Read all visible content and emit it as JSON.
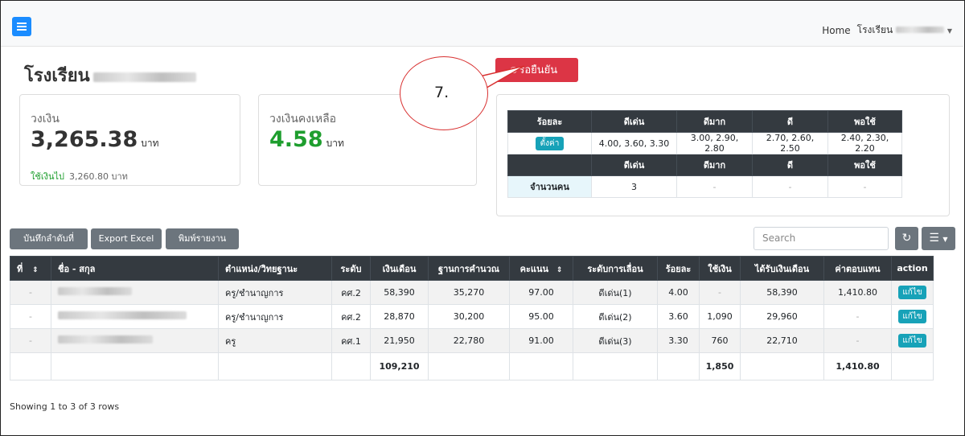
{
  "navbar": {
    "home": "Home",
    "user_menu": "โรงเรียน"
  },
  "title": "โรงเรียน",
  "cards": {
    "budget": {
      "label": "วงเงิน",
      "value": "3,265.38",
      "unit": "บาท",
      "used_label": "ใช้เงินไป",
      "used_value": "3,260.80 บาท"
    },
    "remaining": {
      "label": "วงเงินคงเหลือ",
      "value": "4.58",
      "unit": "บาท"
    }
  },
  "pending_label": "รอยืนยัน",
  "annotation": "7.",
  "rate_table": {
    "header": [
      "ร้อยละ",
      "ดีเด่น",
      "ดีมาก",
      "ดี",
      "พอใช้"
    ],
    "config_label": "ตั้งค่า",
    "percents": [
      "4.00, 3.60, 3.30",
      "3.00, 2.90, 2.80",
      "2.70, 2.60, 2.50",
      "2.40, 2.30, 2.20"
    ],
    "header2": [
      "ดีเด่น",
      "ดีมาก",
      "ดี",
      "พอใช้"
    ],
    "count_label": "จำนวนคน",
    "counts": [
      "3",
      "-",
      "-",
      "-"
    ]
  },
  "toolbar": {
    "save": "บันทึกลำดับที่",
    "export": "Export Excel",
    "print": "พิมพ์รายงาน",
    "search_placeholder": "Search"
  },
  "table": {
    "columns": [
      "ที่",
      "ชื่อ - สกุล",
      "ตำแหน่ง/วิทยฐานะ",
      "ระดับ",
      "เงินเดือน",
      "ฐานการคำนวณ",
      "คะแนน",
      "ระดับการเลื่อน",
      "ร้อยละ",
      "ใช้เงิน",
      "ได้รับเงินเดือน",
      "ค่าตอบแทน",
      "action"
    ],
    "rows": [
      {
        "no": "-",
        "position": "ครู/ชำนาญการ",
        "level": "คศ.2",
        "salary": "58,390",
        "base": "35,270",
        "score": "97.00",
        "grade": "ดีเด่น(1)",
        "percent": "4.00",
        "used": "-",
        "received": "58,390",
        "comp": "1,410.80",
        "action": "แก้ไข"
      },
      {
        "no": "-",
        "position": "ครู/ชำนาญการ",
        "level": "คศ.2",
        "salary": "28,870",
        "base": "30,200",
        "score": "95.00",
        "grade": "ดีเด่น(2)",
        "percent": "3.60",
        "used": "1,090",
        "received": "29,960",
        "comp": "-",
        "action": "แก้ไข"
      },
      {
        "no": "-",
        "position": "ครู",
        "level": "คศ.1",
        "salary": "21,950",
        "base": "22,780",
        "score": "91.00",
        "grade": "ดีเด่น(3)",
        "percent": "3.30",
        "used": "760",
        "received": "22,710",
        "comp": "-",
        "action": "แก้ไข"
      }
    ],
    "totals": {
      "salary": "109,210",
      "used": "1,850",
      "comp": "1,410.80"
    }
  },
  "footer": "Showing 1 to 3 of 3 rows"
}
